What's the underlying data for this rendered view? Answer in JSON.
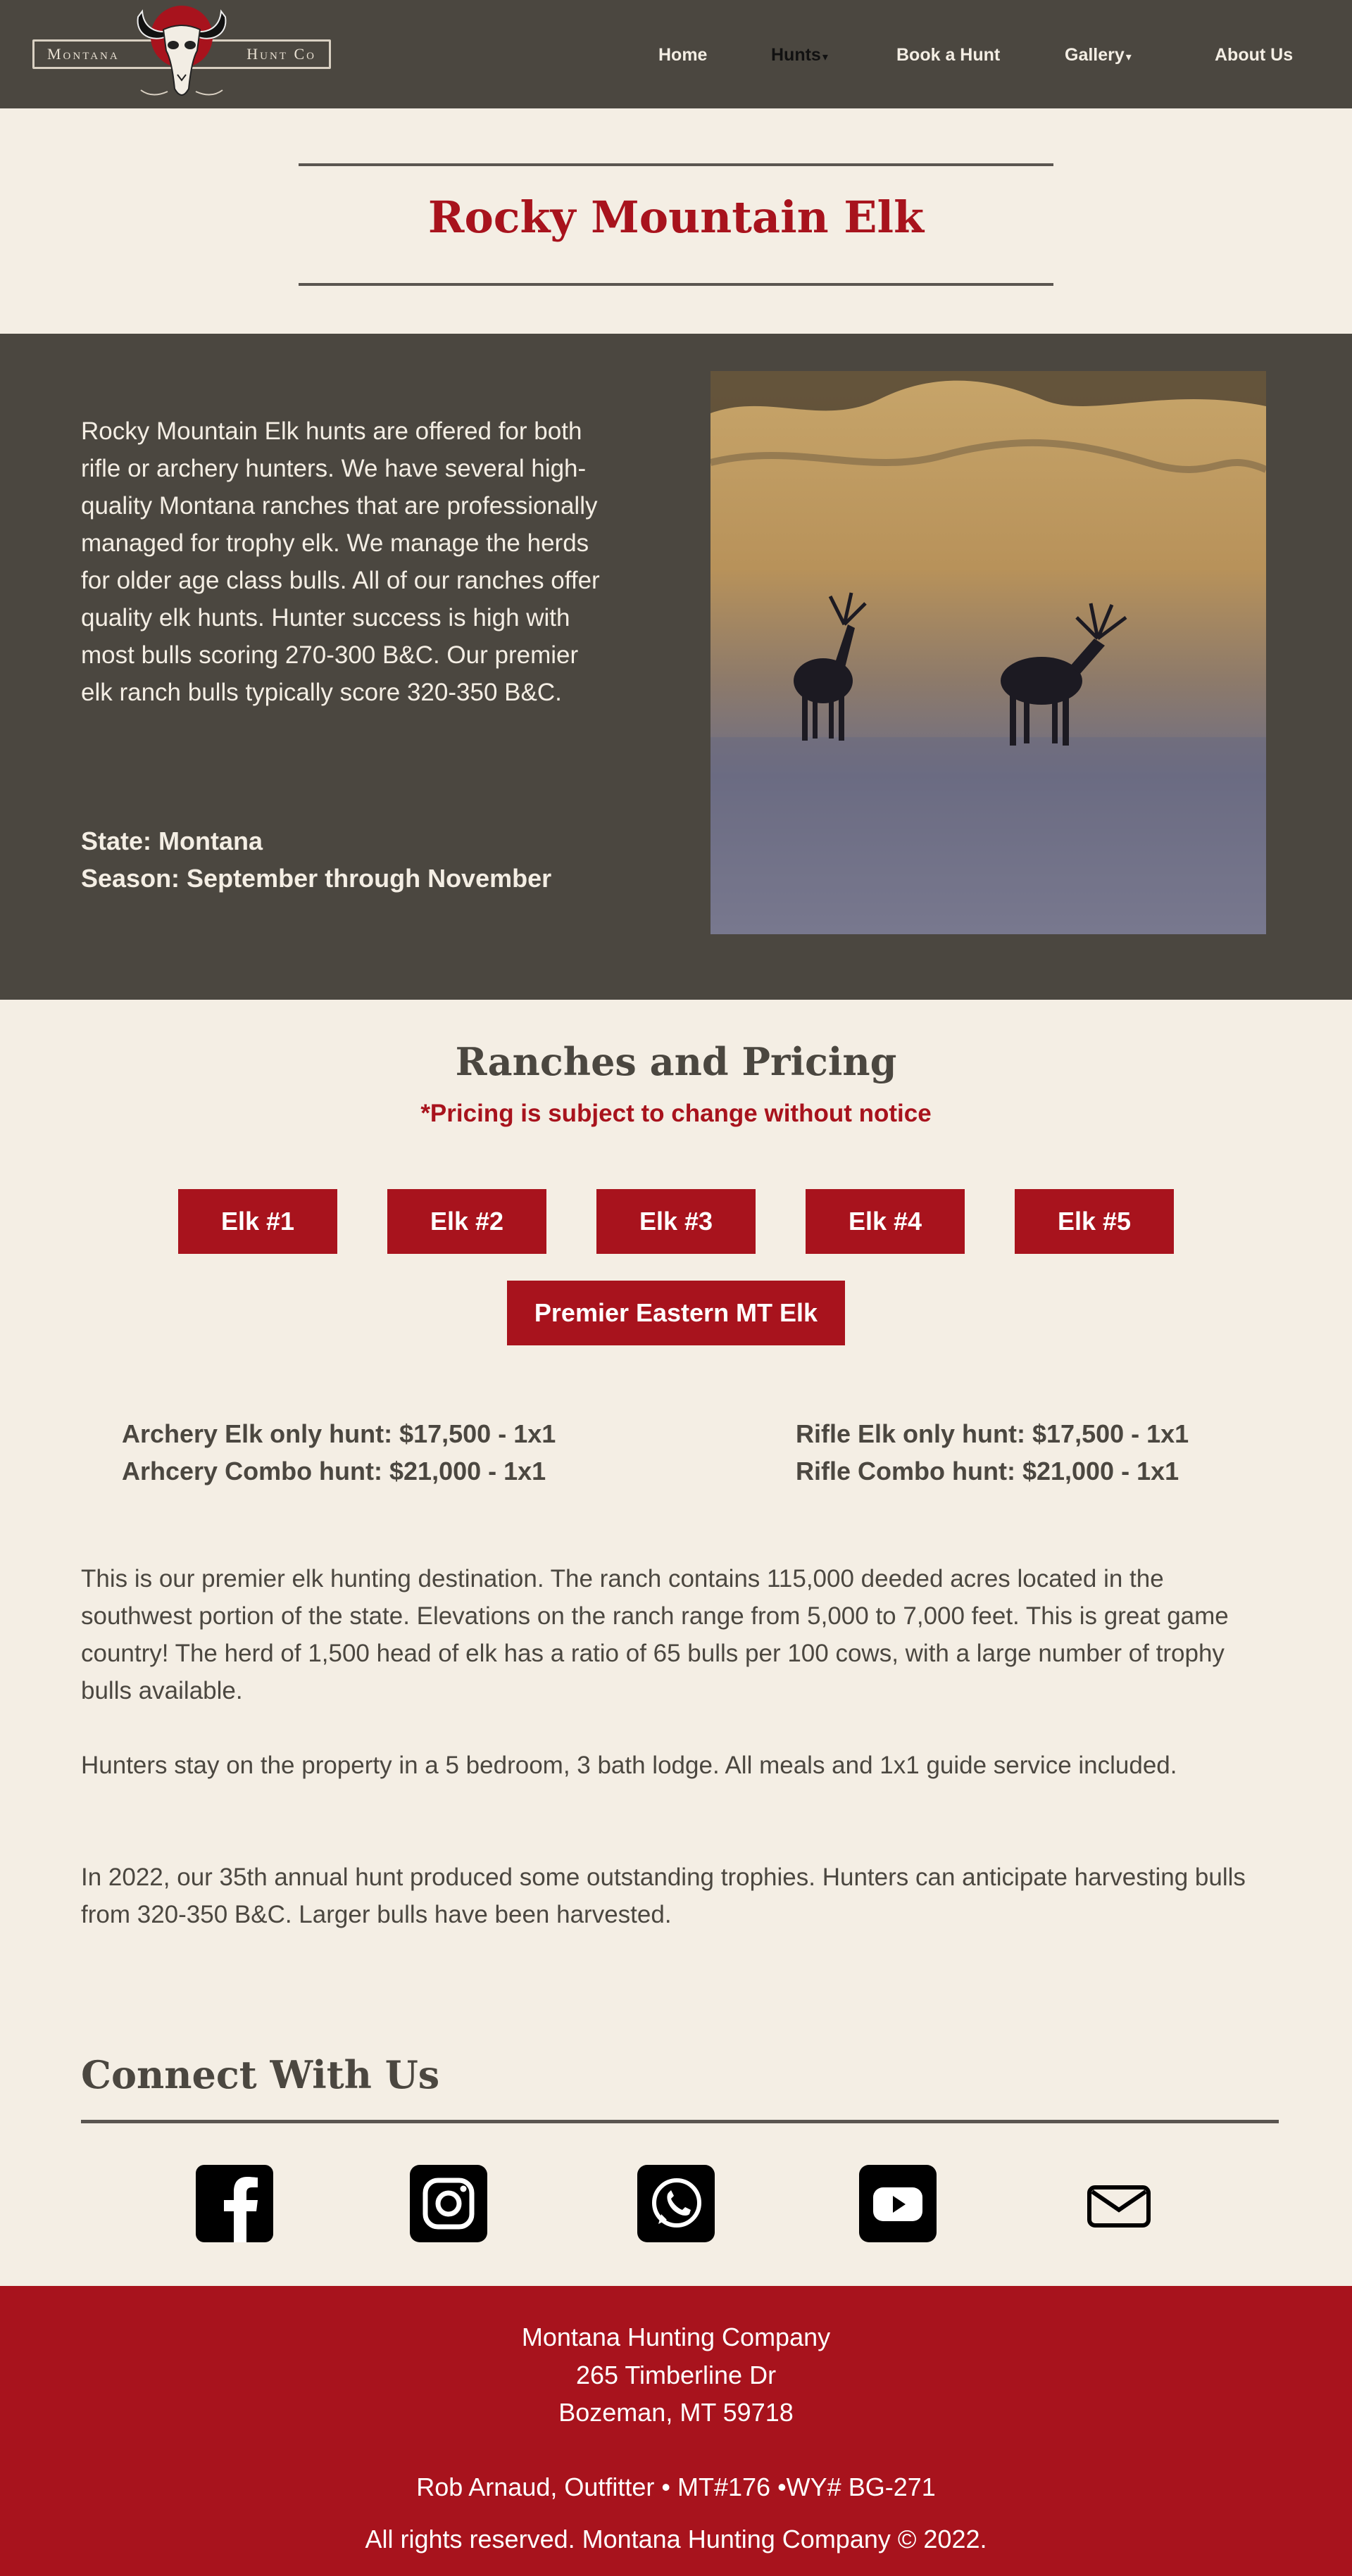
{
  "header": {
    "logo": {
      "left_word": "Montana",
      "right_word": "Hunt Co"
    },
    "nav": [
      {
        "label": "Home",
        "caret": ""
      },
      {
        "label": "Hunts",
        "caret": "▾"
      },
      {
        "label": "Book a Hunt",
        "caret": ""
      },
      {
        "label": "Gallery",
        "caret": "▾"
      },
      {
        "label": "About Us",
        "caret": ""
      }
    ]
  },
  "page": {
    "title": "Rocky Mountain Elk"
  },
  "intro": {
    "text": "Rocky Mountain Elk hunts are offered for both rifle or archery hunters. We have several high-quality Montana ranches that are professionally managed for trophy elk. We manage the herds for older age class bulls. All of our ranches offer quality elk hunts. Hunter success is high with most bulls scoring 270-300 B&C. Our premier elk ranch bulls typically score 320-350 B&C.",
    "state": "State: Montana",
    "season": "Season: September through November"
  },
  "ranches": {
    "title": "Ranches and Pricing",
    "note": "*Pricing is subject to change without notice",
    "tabs": [
      "Elk #1",
      "Elk #2",
      "Elk #3",
      "Elk #4",
      "Elk #5",
      "Premier Eastern MT Elk"
    ],
    "archery": [
      "Archery Elk only hunt: $17,500 - 1x1",
      "Arhcery Combo hunt: $21,000 - 1x1"
    ],
    "rifle": [
      "Rifle Elk only hunt: $17,500 - 1x1",
      "Rifle Combo hunt: $21,000 - 1x1"
    ],
    "paragraphs": [
      "This is our premier elk hunting destination. The ranch contains 115,000 deeded acres located in the southwest portion of the state. Elevations on the ranch range from 5,000 to 7,000 feet. This is great game country! The herd of 1,500 head of elk has a ratio of 65 bulls per 100 cows, with a large number of trophy bulls available.",
      "Hunters stay on the property in a 5 bedroom, 3 bath lodge. All meals and 1x1 guide service included.",
      "In 2022, our 35th annual hunt produced some outstanding trophies. Hunters can anticipate harvesting bulls from 320-350 B&C. Larger bulls have been harvested."
    ]
  },
  "connect": {
    "title": "Connect With Us",
    "icons": [
      "facebook-icon",
      "instagram-icon",
      "whatsapp-icon",
      "youtube-icon",
      "email-icon"
    ]
  },
  "footer": {
    "company": "Montana Hunting Company",
    "street": "265 Timberline Dr",
    "city": "Bozeman, MT 59718",
    "outfitter": "Rob Arnaud, Outfitter • MT#176 •WY# BG-271",
    "rights": "All rights reserved. Montana Hunting Company © 2022."
  },
  "colors": {
    "brand_red": "#a8131d",
    "header_brown": "#4b4740",
    "page_bg": "#f4eee4"
  }
}
